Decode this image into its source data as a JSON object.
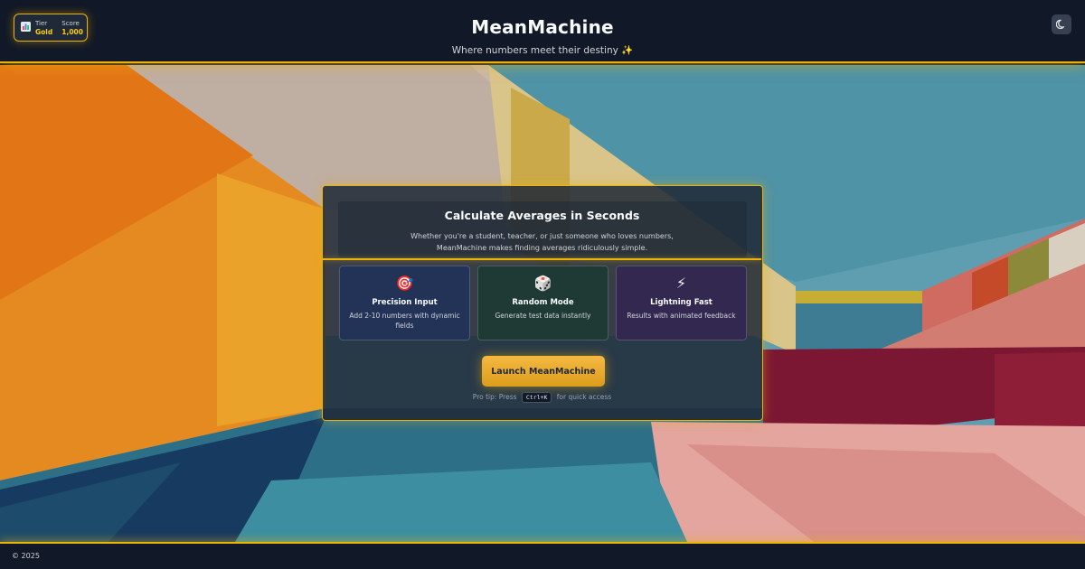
{
  "header": {
    "title": "MeanMachine",
    "subtitle": "Where numbers meet their destiny ✨",
    "tier_label": "Tier",
    "tier_value": "Gold",
    "score_label": "Score",
    "score_value": "1,000",
    "tier_icon": "bar-chart-icon",
    "theme_icon": "moon-icon"
  },
  "card": {
    "title": "Calculate Averages in Seconds",
    "description_line1": "Whether you're a student, teacher, or just someone who loves numbers,",
    "description_line2": "MeanMachine makes finding averages ridiculously simple.",
    "features": [
      {
        "icon": "🎯",
        "icon_name": "target-icon",
        "title": "Precision Input",
        "desc_line1": "Add 2-10 numbers with dynamic",
        "desc_line2": "fields"
      },
      {
        "icon": "🎲",
        "icon_name": "dice-icon",
        "title": "Random Mode",
        "desc_line1": "Generate test data instantly",
        "desc_line2": ""
      },
      {
        "icon": "⚡",
        "icon_name": "lightning-icon",
        "title": "Lightning Fast",
        "desc_line1": "Results with animated feedback",
        "desc_line2": ""
      }
    ],
    "launch_label": "Launch MeanMachine",
    "protip_prefix": "Pro tip: Press",
    "protip_key": "Ctrl+K",
    "protip_suffix": "for quick access"
  },
  "footer": {
    "text": "© 2025"
  },
  "colors": {
    "accent": "#eab308",
    "header_bg": "#111827",
    "button_gold": "#f5b942"
  }
}
